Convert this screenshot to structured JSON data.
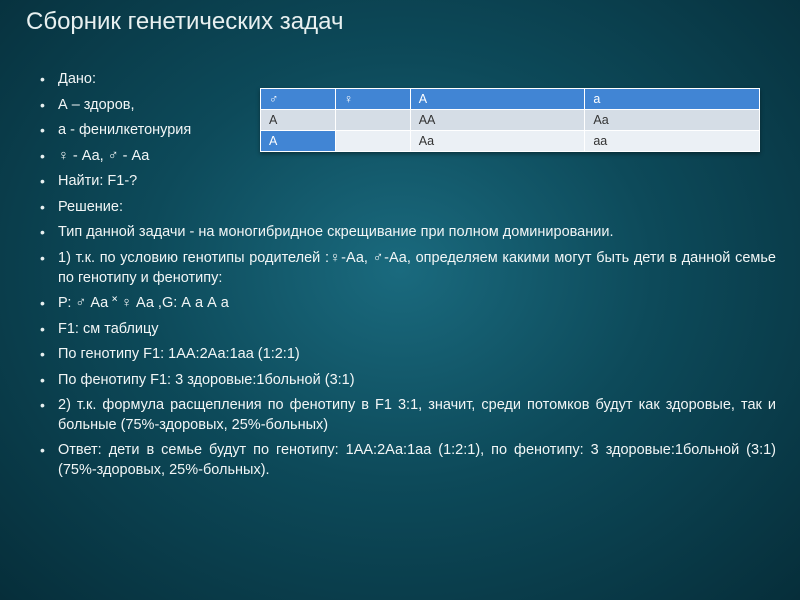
{
  "title": "Сборник генетических задач",
  "bullets": [
    {
      "text": "Дано:",
      "wide": false
    },
    {
      "text": "А – здоров,",
      "wide": false
    },
    {
      "text": "а - фенилкетонурия",
      "wide": false
    },
    {
      "text": "♀ - Аа, ♂ - Аа",
      "wide": false
    },
    {
      "text": "Найти: F1-?",
      "wide": false
    },
    {
      "text": "Решение:",
      "wide": false
    },
    {
      "text": "Тип данной задачи - на моногибридное  скрещивание при полном доминировании.",
      "wide": true
    },
    {
      "text": "1) т.к. по условию генотипы родителей :♀-Аа,  ♂-Аа,   определяем какими могут быть дети в данной семье  по генотипу и фенотипу:",
      "wide": true
    },
    {
      "text": "Р: ♂ Аа ˟ ♀ Аа ,G:   А  а     А    а",
      "wide": false
    },
    {
      "text": "F1: см таблицу",
      "wide": false
    },
    {
      "text": "По генотипу F1: 1АА:2Аа:1аа (1:2:1)",
      "wide": false
    },
    {
      "text": "По фенотипу F1: 3 здоровые:1больной (3:1)",
      "wide": false
    },
    {
      "text": "2) т.к. формула расщепления по фенотипу в F1 3:1, значит, среди потомков будут как здоровые, так и больные (75%-здоровых, 25%-больных)",
      "wide": true
    },
    {
      "text": "Ответ: дети в семье будут по генотипу: 1АА:2Аа:1аа (1:2:1), по фенотипу: 3 здоровые:1больной (3:1) (75%-здоровых, 25%-больных).",
      "wide": true
    }
  ],
  "table": {
    "header": [
      "♂",
      "♀",
      "А",
      "а"
    ],
    "rows": [
      [
        "А",
        "",
        "АА",
        "Аа"
      ],
      [
        "А",
        "",
        "Аа",
        " аа"
      ]
    ]
  },
  "chart_data": {
    "type": "table",
    "title": "Punnett square (monohybrid Aa × Aa)",
    "columns": [
      "♂ gamete row label",
      "♀ (blank)",
      "А",
      "а"
    ],
    "rows": [
      {
        "label": "А",
        "cells": [
          "АА",
          "Аа"
        ]
      },
      {
        "label": "А",
        "cells": [
          "Аа",
          "аа"
        ]
      }
    ],
    "genotype_ratio": {
      "АА": 1,
      "Аа": 2,
      "аа": 1
    },
    "phenotype_ratio": {
      "здоровые": 3,
      "больной": 1
    },
    "phenotype_percent": {
      "здоровых": 75,
      "больных": 25
    }
  }
}
